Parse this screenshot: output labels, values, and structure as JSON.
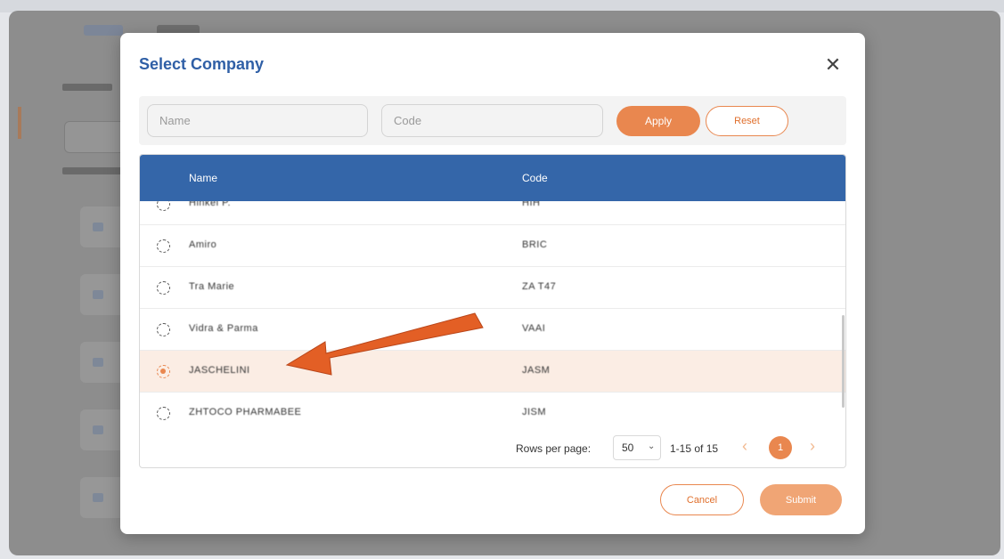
{
  "modal": {
    "title": "Select Company",
    "close_icon": "close-icon",
    "filters": {
      "name_placeholder": "Name",
      "name_value": "",
      "code_placeholder": "Code",
      "code_value": "",
      "apply_label": "Apply",
      "reset_label": "Reset"
    },
    "table": {
      "columns": [
        "Name",
        "Code"
      ],
      "rows": [
        {
          "name": "Hinkel P.",
          "code": "HIH",
          "selected": false
        },
        {
          "name": "Amiro",
          "code": "BRIC",
          "selected": false
        },
        {
          "name": "Tra Marie",
          "code": "ZA T47",
          "selected": false
        },
        {
          "name": "Vidra & Parma",
          "code": "VAAI",
          "selected": false
        },
        {
          "name": "JASCHELINI",
          "code": "JASM",
          "selected": true
        },
        {
          "name": "ZHTOCO PHARMABEE",
          "code": "JISM",
          "selected": false
        }
      ]
    },
    "pagination": {
      "rows_per_page_label": "Rows per page:",
      "rows_per_page_value": "50",
      "range_text": "1-15 of 15",
      "current_page": "1"
    },
    "cancel_label": "Cancel",
    "submit_label": "Submit"
  },
  "colors": {
    "accent": "#e9874f",
    "header": "#3466a9",
    "title": "#2f5fa6",
    "selected_row": "#fbede4"
  }
}
